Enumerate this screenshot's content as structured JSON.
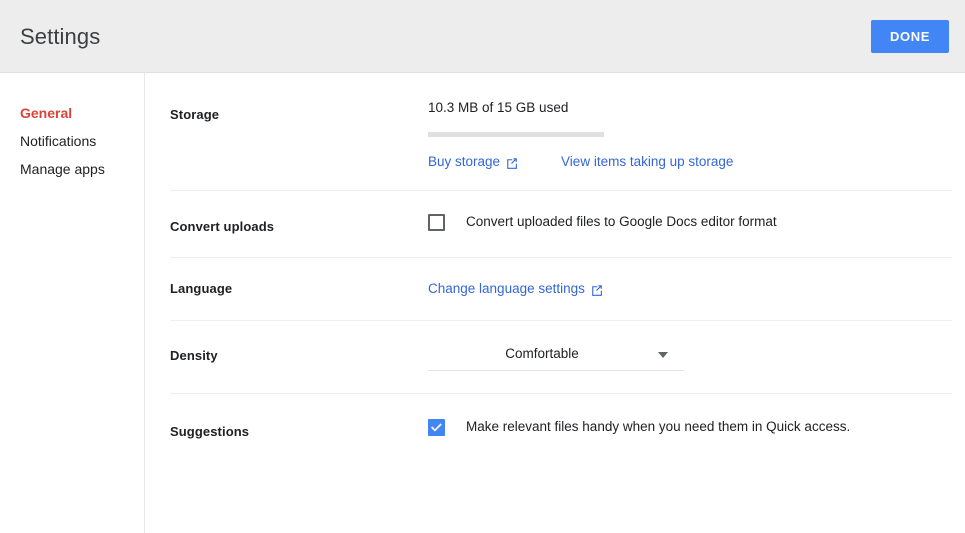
{
  "header": {
    "title": "Settings",
    "done_label": "DONE",
    "accent_blue": "#4285f4"
  },
  "sidebar": {
    "items": [
      {
        "label": "General",
        "active": true
      },
      {
        "label": "Notifications",
        "active": false
      },
      {
        "label": "Manage apps",
        "active": false
      }
    ],
    "active_color": "#db4437"
  },
  "sections": {
    "storage": {
      "label": "Storage",
      "used_text": "10.3 MB of 15 GB used",
      "buy_link": "Buy storage",
      "view_link": "View items taking up storage",
      "link_color": "#3367d6"
    },
    "convert_uploads": {
      "label": "Convert uploads",
      "checkbox_label": "Convert uploaded files to Google Docs editor format",
      "checked": false
    },
    "language": {
      "label": "Language",
      "link": "Change language settings"
    },
    "density": {
      "label": "Density",
      "value": "Comfortable"
    },
    "suggestions": {
      "label": "Suggestions",
      "checkbox_label": "Make relevant files handy when you need them in Quick access.",
      "checked": true
    }
  }
}
